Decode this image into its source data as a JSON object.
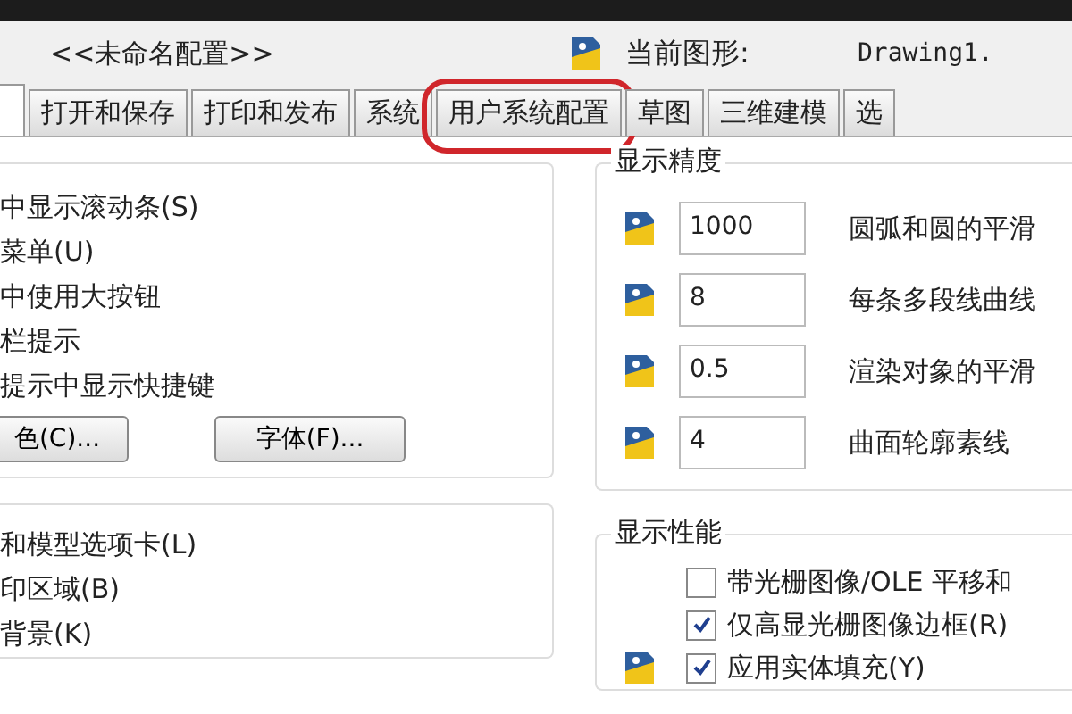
{
  "header": {
    "profile": "<<未命名配置>>",
    "current_drawing_label": "当前图形:",
    "current_drawing": "Drawing1."
  },
  "tabs": [
    {
      "selected": true
    },
    {
      "label": "打开和保存",
      "selected": false
    },
    {
      "label": "打印和发布",
      "selected": false
    },
    {
      "label": "系统",
      "selected": false
    },
    {
      "label": "用户系统配置",
      "selected": false,
      "circled": true
    },
    {
      "label": "草图",
      "selected": false
    },
    {
      "label": "三维建模",
      "selected": false
    },
    {
      "label": "选",
      "selected": false
    }
  ],
  "window_elements": {
    "options": [
      "中显示滚动条(S)",
      "菜单(U)",
      "中使用大按钮",
      "栏提示",
      "提示中显示快捷键"
    ],
    "buttons": [
      "色(C)...",
      "字体(F)..."
    ]
  },
  "layout_elements": {
    "options": [
      "和模型选项卡(L)",
      "印区域(B)",
      "背景(K)"
    ]
  },
  "display_resolution": {
    "title": "显示精度",
    "rows": [
      {
        "value": "1000",
        "label": "圆弧和圆的平滑"
      },
      {
        "value": "8",
        "label": "每条多段线曲线"
      },
      {
        "value": "0.5",
        "label": "渲染对象的平滑"
      },
      {
        "value": "4",
        "label": "曲面轮廓素线"
      }
    ]
  },
  "display_performance": {
    "title": "显示性能",
    "options": [
      {
        "label": "带光栅图像/OLE 平移和",
        "checked": false,
        "icon": false
      },
      {
        "label": "仅高显光栅图像边框(R)",
        "checked": true,
        "icon": false
      },
      {
        "label": "应用实体填充(Y)",
        "checked": true,
        "icon": true
      }
    ]
  }
}
